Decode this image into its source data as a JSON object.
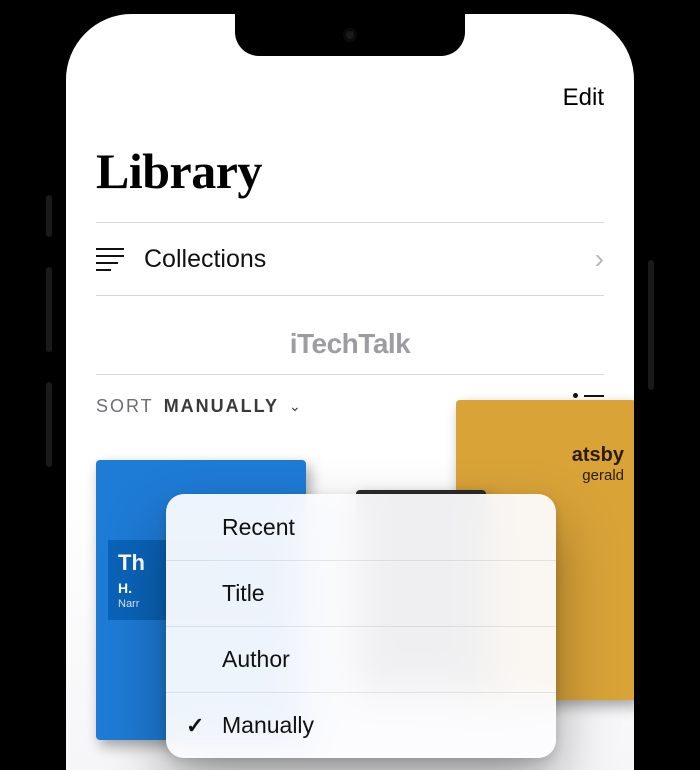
{
  "topbar": {
    "edit": "Edit"
  },
  "title": "Library",
  "collections": {
    "label": "Collections"
  },
  "watermark": "iTechTalk",
  "sort": {
    "label": "SORT",
    "value": "MANUALLY",
    "options": [
      "Recent",
      "Title",
      "Author",
      "Manually"
    ],
    "selected_index": 3
  },
  "books": {
    "blue": {
      "title_prefix": "Th",
      "author_prefix": "H.",
      "subtitle_prefix": "Narr"
    },
    "gold": {
      "title_suffix": "atsby",
      "author_suffix": "gerald"
    }
  }
}
